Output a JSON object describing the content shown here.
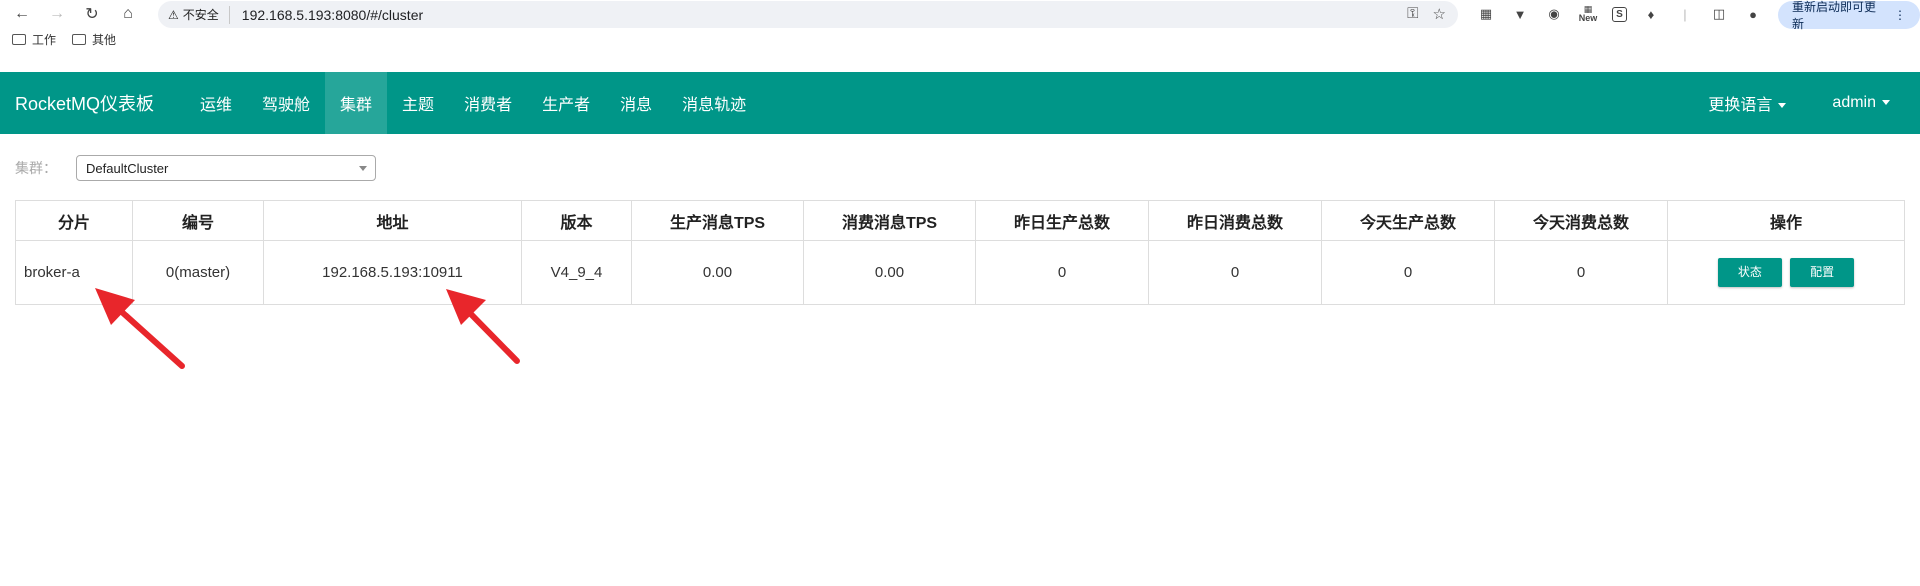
{
  "browser": {
    "security_label": "不安全",
    "url": "192.168.5.193:8080/#/cluster",
    "ext_new_label": "New",
    "ext_s_label": "S",
    "restart_label": "重新启动即可更新",
    "bookmarks": [
      {
        "label": "工作"
      },
      {
        "label": "其他"
      }
    ]
  },
  "navbar": {
    "brand": "RocketMQ仪表板",
    "items": [
      {
        "label": "运维"
      },
      {
        "label": "驾驶舱"
      },
      {
        "label": "集群"
      },
      {
        "label": "主题"
      },
      {
        "label": "消费者"
      },
      {
        "label": "生产者"
      },
      {
        "label": "消息"
      },
      {
        "label": "消息轨迹"
      }
    ],
    "active_index": 2,
    "language_label": "更换语言",
    "user_label": "admin"
  },
  "filter": {
    "label": "集群：",
    "selected": "DefaultCluster"
  },
  "table": {
    "headers": [
      "分片",
      "编号",
      "地址",
      "版本",
      "生产消息TPS",
      "消费消息TPS",
      "昨日生产总数",
      "昨日消费总数",
      "今天生产总数",
      "今天消费总数",
      "操作"
    ],
    "rows": [
      {
        "shard": "broker-a",
        "index": "0(master)",
        "address": "192.168.5.193:10911",
        "version": "V4_9_4",
        "produce_tps": "0.00",
        "consume_tps": "0.00",
        "yesterday_produce": "0",
        "yesterday_consume": "0",
        "today_produce": "0",
        "today_consume": "0",
        "btn_status": "状态",
        "btn_config": "配置"
      }
    ]
  },
  "colors": {
    "primary": "#009688",
    "active_nav": "#26a69a",
    "annotation": "#e8262b"
  }
}
